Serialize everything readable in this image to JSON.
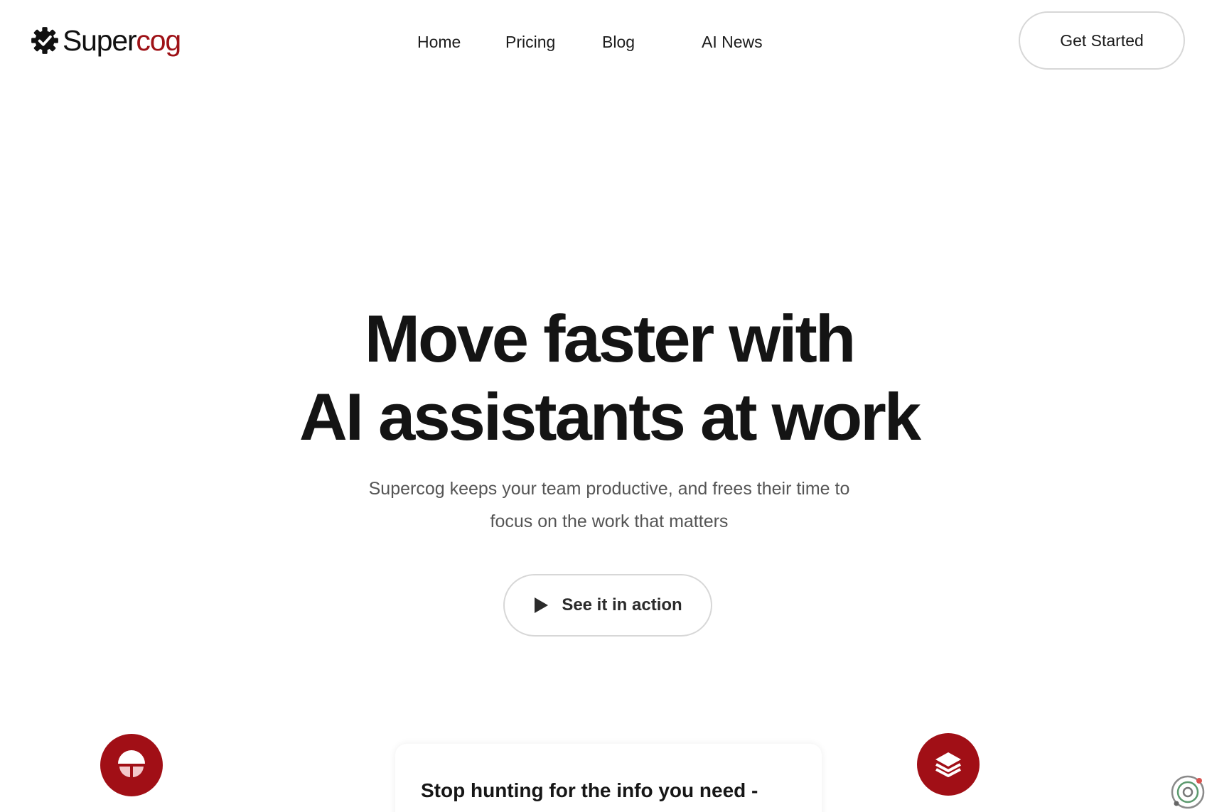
{
  "brand": {
    "name_part1": "Super",
    "name_part2": "cog",
    "logo_icon": "gear-check-icon",
    "colors": {
      "dark": "#111111",
      "accent": "#9e1116"
    }
  },
  "nav": {
    "items": [
      {
        "label": "Home"
      },
      {
        "label": "Pricing"
      },
      {
        "label": "Blog"
      },
      {
        "label": "AI News"
      }
    ]
  },
  "header": {
    "cta_label": "Get Started"
  },
  "hero": {
    "title_line1": "Move faster with",
    "title_line2": "AI assistants at work",
    "subtitle_line1": "Supercog keeps your team productive, and frees their time to",
    "subtitle_line2": "focus on the work that matters",
    "cta_label": "See it in action",
    "cta_icon": "play-icon"
  },
  "features": {
    "heading": "Stop hunting for the info you need -",
    "left_badge_icon": "brain-icon",
    "right_badge_icon": "layers-icon",
    "accent_color": "#a10f16"
  },
  "widget": {
    "icon": "orbit-icon"
  }
}
